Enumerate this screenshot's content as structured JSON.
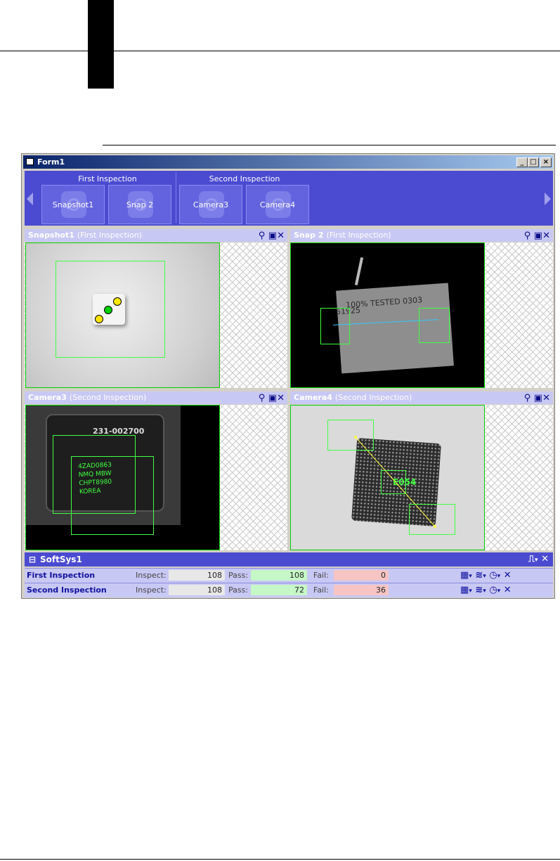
{
  "window": {
    "title": "Form1",
    "minimize": "_",
    "maximize": "□",
    "close": "×"
  },
  "ribbon": {
    "groups": [
      {
        "label": "First Inspection",
        "tiles": [
          "Snapshot1",
          "Snap 2"
        ]
      },
      {
        "label": "Second Inspection",
        "tiles": [
          "Camera3",
          "Camera4"
        ]
      }
    ]
  },
  "panels": [
    {
      "name": "Snapshot1",
      "inspection": "(First Inspection)"
    },
    {
      "name": "Snap 2",
      "inspection": "(First Inspection)"
    },
    {
      "name": "Camera3",
      "inspection": "(Second Inspection)"
    },
    {
      "name": "Camera4",
      "inspection": "(Second Inspection)"
    }
  ],
  "image_text": {
    "snap2_label": "100% TESTED 0303",
    "snap2_code": "51925",
    "camera3_label": "231-002700",
    "camera3_lines": [
      "4ZAD0863",
      "NMQ   MBW",
      "CHPT8980",
      "KOREA"
    ],
    "camera4_label": "E054"
  },
  "system": {
    "collapse": "⊟",
    "name": "SoftSys1",
    "rows": [
      {
        "name": "First Inspection",
        "inspect_label": "Inspect:",
        "inspect": "108",
        "pass_label": "Pass:",
        "pass": "108",
        "fail_label": "Fail:",
        "fail": "0"
      },
      {
        "name": "Second Inspection",
        "inspect_label": "Inspect:",
        "inspect": "108",
        "pass_label": "Pass:",
        "pass": "72",
        "fail_label": "Fail:",
        "fail": "36"
      }
    ]
  },
  "colors": {
    "ribbon": "#4b4bd1",
    "panel_header": "#c8c8f4",
    "roi": "#40ff40",
    "pass_field": "#c6f7c6",
    "fail_field": "#f7c4c4",
    "inspect_field": "#e8e8e8"
  },
  "icons": [
    "zoom-icon",
    "save-icon",
    "tools-icon",
    "trigger-icon",
    "table-icon",
    "filter-icon",
    "clock-icon"
  ]
}
